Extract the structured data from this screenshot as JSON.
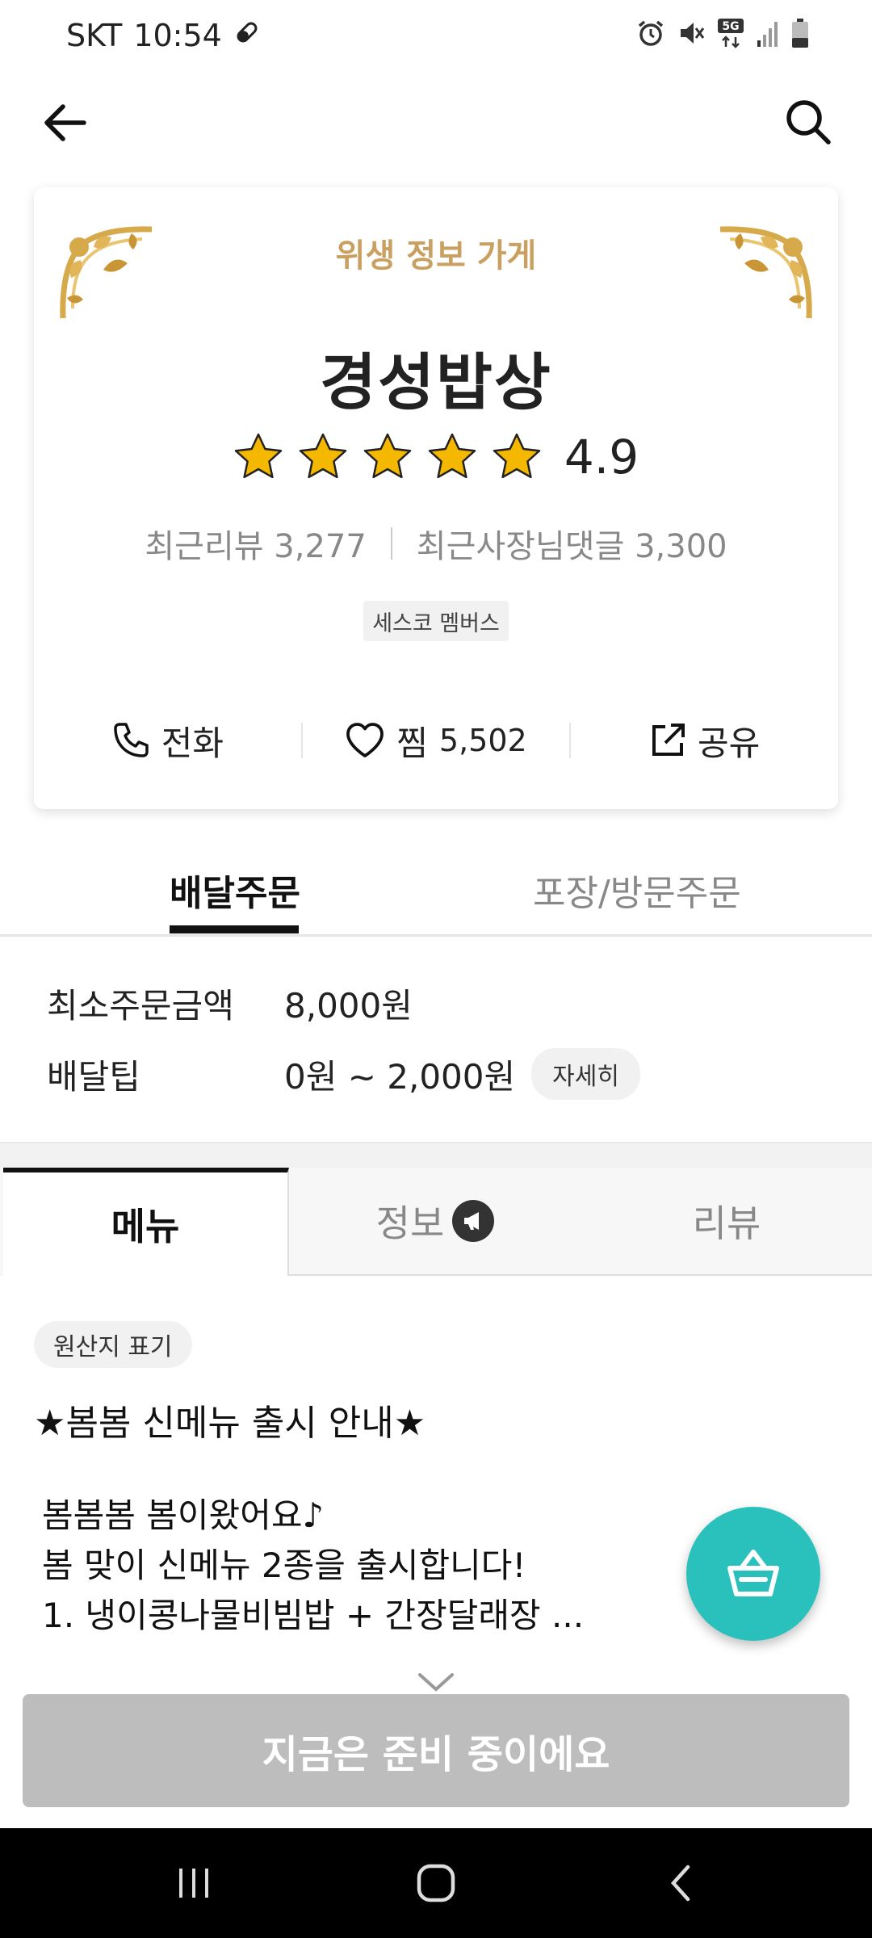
{
  "status_bar": {
    "carrier": "SKT",
    "time": "10:54",
    "network": "5G",
    "icons": [
      "alarm-icon",
      "mute-icon",
      "5g-data-icon",
      "signal-icon",
      "battery-icon"
    ]
  },
  "nav": {
    "back_icon": "back-arrow-icon",
    "search_icon": "search-icon"
  },
  "store": {
    "hygiene_label": "위생 정보 가게",
    "name": "경성밥상",
    "stars": 5,
    "rating": "4.9",
    "recent_reviews": "최근리뷰 3,277",
    "recent_owner_replies": "최근사장님댓글 3,300",
    "member_badge": "세스코 멤버스",
    "actions": {
      "call": "전화",
      "like": "찜",
      "like_count": "5,502",
      "share": "공유"
    }
  },
  "order_tabs": {
    "delivery": "배달주문",
    "pickup": "포장/방문주문",
    "selected": "delivery"
  },
  "order_info": {
    "min_order_label": "최소주문금액",
    "min_order_value": "8,000원",
    "delivery_tip_label": "배달팁",
    "delivery_tip_value": "0원 ~ 2,000원",
    "detail_button": "자세히"
  },
  "content_tabs": {
    "menu": "메뉴",
    "info": "정보",
    "review": "리뷰",
    "selected": "menu"
  },
  "notice": {
    "origin_label": "원산지 표기",
    "title": "★봄봄 신메뉴 출시 안내★",
    "lines": [
      "봄봄봄 봄이왔어요♪",
      "봄 맞이 신메뉴 2종을 출시합니다!",
      "1. 냉이콩나물비빔밥 + 간장달래장 ..."
    ]
  },
  "ready_button": "지금은 준비 중이에요",
  "colors": {
    "accent_gold": "#c9a060",
    "star_gold": "#f5b800",
    "cart_teal": "#2ac1bc",
    "disabled_gray": "#bdbdbd"
  }
}
